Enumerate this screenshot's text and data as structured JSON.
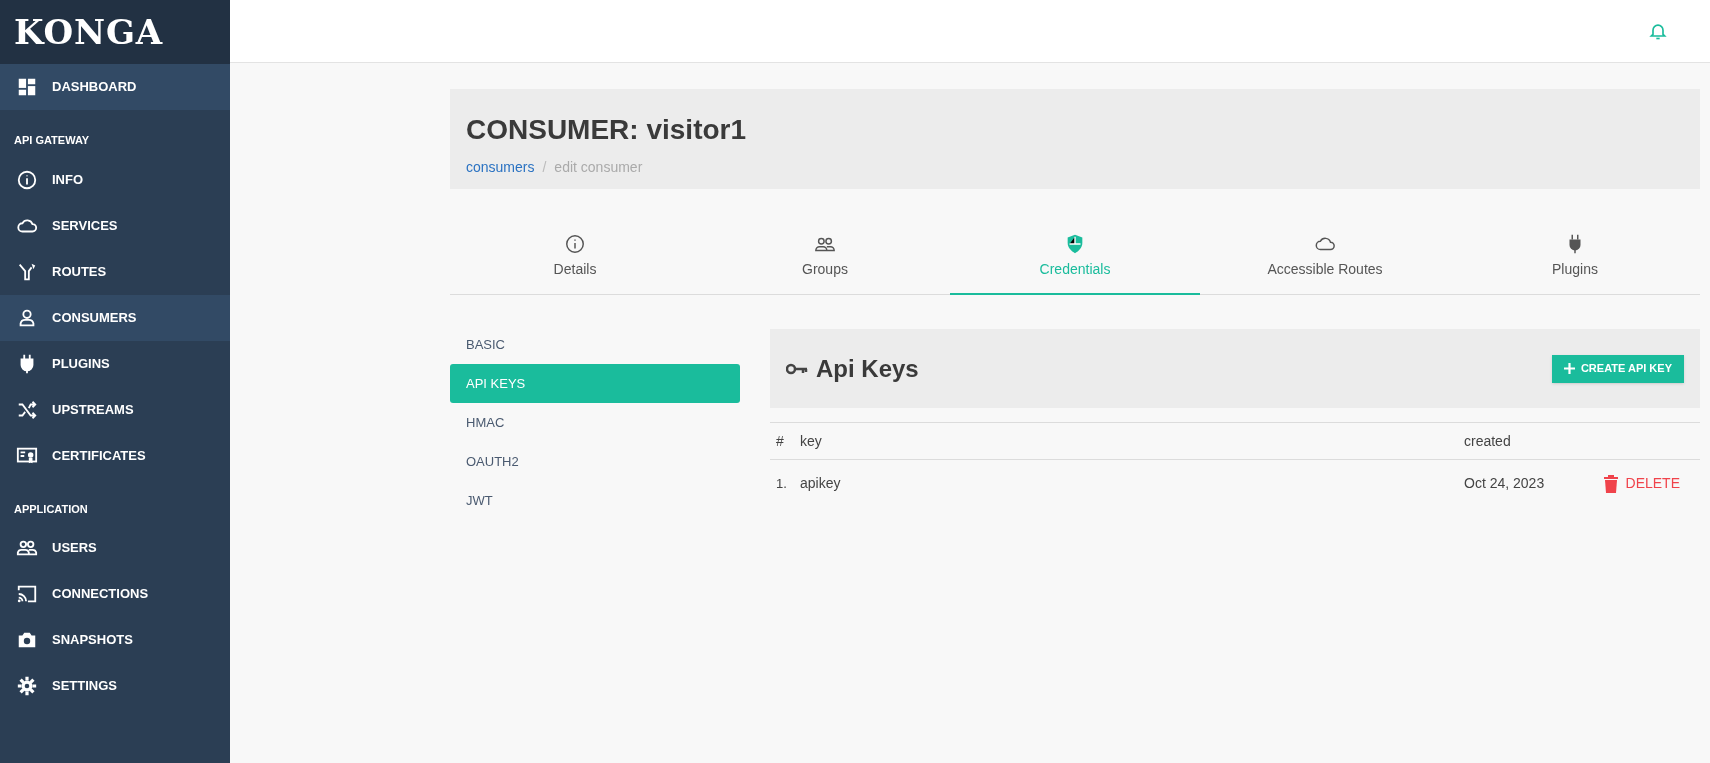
{
  "sidebar": {
    "logo": "KONGA",
    "sections": [
      {
        "items": [
          {
            "label": "DASHBOARD",
            "selected": true
          }
        ]
      },
      {
        "title": "API GATEWAY",
        "items": [
          {
            "label": "INFO",
            "selected": false
          },
          {
            "label": "SERVICES",
            "selected": false
          },
          {
            "label": "ROUTES",
            "selected": false
          },
          {
            "label": "CONSUMERS",
            "selected": true
          },
          {
            "label": "PLUGINS",
            "selected": false
          },
          {
            "label": "UPSTREAMS",
            "selected": false
          },
          {
            "label": "CERTIFICATES",
            "selected": false
          }
        ]
      },
      {
        "title": "APPLICATION",
        "items": [
          {
            "label": "USERS",
            "selected": false
          },
          {
            "label": "CONNECTIONS",
            "selected": false
          },
          {
            "label": "SNAPSHOTS",
            "selected": false
          },
          {
            "label": "SETTINGS",
            "selected": false
          }
        ]
      }
    ]
  },
  "header": {
    "title": "CONSUMER: visitor1",
    "breadcrumb_separator": "/",
    "breadcrumb": [
      {
        "label": "consumers",
        "link": true
      },
      {
        "label": "edit consumer",
        "link": false
      }
    ]
  },
  "tabs": [
    {
      "label": "Details",
      "selected": false
    },
    {
      "label": "Groups",
      "selected": false
    },
    {
      "label": "Credentials",
      "selected": true
    },
    {
      "label": "Accessible Routes",
      "selected": false
    },
    {
      "label": "Plugins",
      "selected": false
    }
  ],
  "credential_types": [
    {
      "label": "BASIC",
      "selected": false
    },
    {
      "label": "API KEYS",
      "selected": true
    },
    {
      "label": "HMAC",
      "selected": false
    },
    {
      "label": "OAUTH2",
      "selected": false
    },
    {
      "label": "JWT",
      "selected": false
    }
  ],
  "panel": {
    "title": "Api Keys",
    "create_button": "CREATE API KEY"
  },
  "table": {
    "columns": [
      "#",
      "key",
      "created"
    ],
    "rows": [
      {
        "index": "1.",
        "key": "apikey",
        "created": "Oct 24, 2023",
        "action": "DELETE"
      }
    ]
  }
}
